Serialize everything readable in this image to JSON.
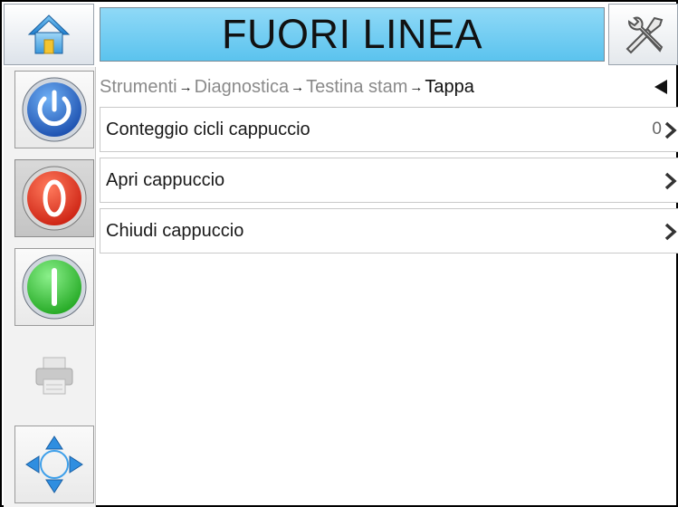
{
  "header": {
    "status_text": "FUORI LINEA",
    "status_color": "#5bc3ee",
    "home_icon": "home-icon",
    "tools_icon": "tools-icon"
  },
  "sidebar": {
    "items": [
      {
        "name": "power",
        "icon": "power-icon",
        "color": "#2c6fd0"
      },
      {
        "name": "stop",
        "icon": "stop-icon",
        "color": "#e8301c"
      },
      {
        "name": "start",
        "icon": "start-icon",
        "color": "#2ec72e"
      },
      {
        "name": "print",
        "icon": "printer-icon",
        "color": "#c4c4c4"
      },
      {
        "name": "navigate",
        "icon": "navigation-arrows-icon",
        "color": "#2f8ee0"
      }
    ]
  },
  "breadcrumb": {
    "items": [
      "Strumenti",
      "Diagnostica",
      "Testina stam",
      "Tappa"
    ],
    "separator": "→"
  },
  "menu": {
    "rows": [
      {
        "label": "Conteggio cicli cappuccio",
        "value": "0"
      },
      {
        "label": "Apri cappuccio",
        "value": ""
      },
      {
        "label": "Chiudi cappuccio",
        "value": ""
      }
    ]
  }
}
